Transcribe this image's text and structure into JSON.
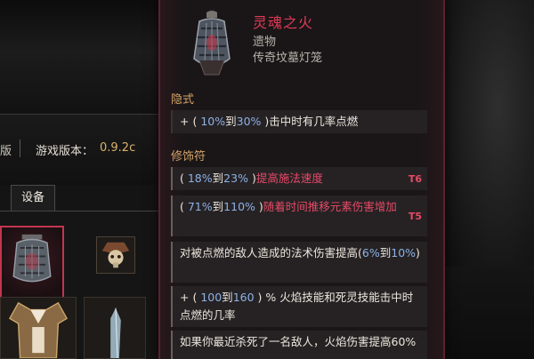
{
  "background": {
    "version_prefix": "版",
    "version_label": "游戏版本：",
    "version_value": "0.9.2c",
    "tab_equipment": "设备"
  },
  "tooltip": {
    "item_name": "灵魂之火",
    "item_type": "遗物",
    "item_rarity": "传奇坟墓灯笼",
    "implicit_label": "隐式",
    "implicit": {
      "plus": "+ ( ",
      "from": "10%",
      "to_word": "到",
      "to": "30%",
      "close": " )",
      "text": "击中时有几率点燃"
    },
    "modifiers_label": "修饰符",
    "modifiers": [
      {
        "open": "( ",
        "from": "18%",
        "to_word": "到",
        "to": "23%",
        "close": " )",
        "text": "提高施法速度",
        "tier": "T6"
      },
      {
        "open": "( ",
        "from": "71%",
        "to_word": "到",
        "to": "110%",
        "close": " )",
        "text": "随着时间推移元素伤害增加",
        "tier": "T5"
      },
      {
        "text_before": "对被点燃的敌人造成的法术伤害提高(",
        "from": "6%",
        "to_word": "到",
        "to": "10%",
        "close": ")"
      },
      {
        "plus": "+ ( ",
        "from": "100",
        "to_word": "到",
        "to": "160",
        "close": " )",
        "text": " % 火焰技能和死灵技能击中时点燃的几率"
      },
      {
        "text": "如果你最近杀死了一名敌人，火焰伤害提高60%"
      }
    ]
  },
  "colors": {
    "unique_name": "#e03a55",
    "range_number": "#8cb2e6",
    "section_label": "#d6a468",
    "version_value": "#d9b46a"
  },
  "icons": {
    "item": "soul-lantern-icon",
    "selected_slot": "lantern-slot-icon",
    "skull_slot": "skull-relic-icon"
  }
}
